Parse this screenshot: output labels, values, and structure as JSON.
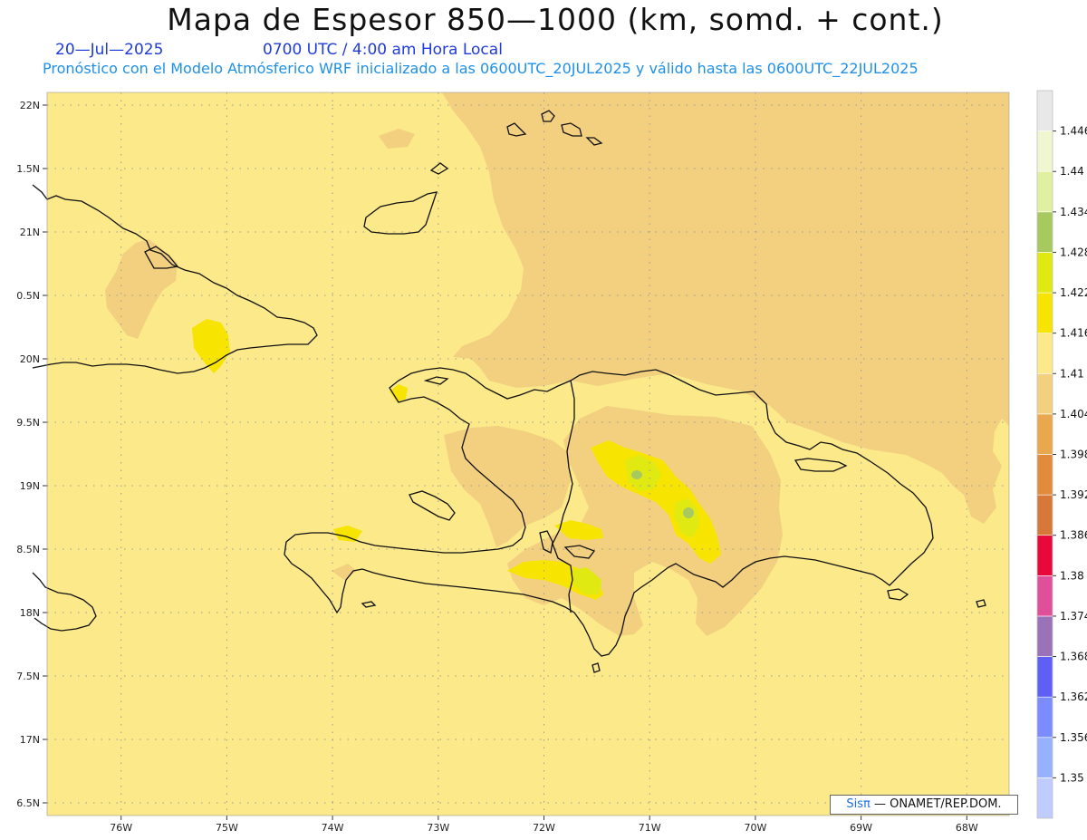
{
  "title": "Mapa de Espesor 850—1000 (km, somd. + cont.)",
  "date": "20—Jul—2025",
  "time": "0700 UTC / 4:00 am Hora Local",
  "model_info": "Pronóstico con el Modelo Atmósferico WRF inicializado a las 0600UTC_20JUL2025 y válido hasta las  0600UTC_22JUL2025",
  "credit": {
    "logo": "Sisπ",
    "text": "— ONAMET/REP.DOM."
  },
  "map": {
    "lon_range": [
      -76.7,
      -67.6
    ],
    "lat_range": [
      16.4,
      22.1
    ],
    "lat_labels": [
      "22N",
      "1.5N",
      "21N",
      "0.5N",
      "20N",
      "9.5N",
      "19N",
      "8.5N",
      "18N",
      "7.5N",
      "17N",
      "6.5N"
    ],
    "lat_values": [
      22,
      21.5,
      21,
      20.5,
      20,
      19.5,
      19,
      18.5,
      18,
      17.5,
      17,
      16.5
    ],
    "lon_labels": [
      "76W",
      "75W",
      "74W",
      "73W",
      "72W",
      "71W",
      "70W",
      "69W",
      "68W"
    ],
    "lon_values": [
      -76,
      -75,
      -74,
      -73,
      -72,
      -71,
      -70,
      -69,
      -68
    ]
  },
  "colorbar": {
    "levels": [
      "1.35",
      "1.356",
      "1.362",
      "1.368",
      "1.374",
      "1.38",
      "1.386",
      "1.392",
      "1.398",
      "1.404",
      "1.41",
      "1.416",
      "1.422",
      "1.428",
      "1.434",
      "1.44",
      "1.446"
    ],
    "colors": [
      "#c0ccff",
      "#96b2ff",
      "#7a8cff",
      "#5f5ff5",
      "#9a72b8",
      "#e0509a",
      "#e8083a",
      "#d87838",
      "#e08c3c",
      "#eaa84e",
      "#f2d080",
      "#fbe98a",
      "#f7e400",
      "#e0ea12",
      "#a8c860",
      "#e0f0a0",
      "#f0f6d0",
      "#e8e8e8"
    ]
  },
  "colors": {
    "base": "#fbe98a",
    "warm": "#f2d080",
    "yellow": "#f7e400",
    "lime": "#e0ea12",
    "green": "#a8c860"
  }
}
